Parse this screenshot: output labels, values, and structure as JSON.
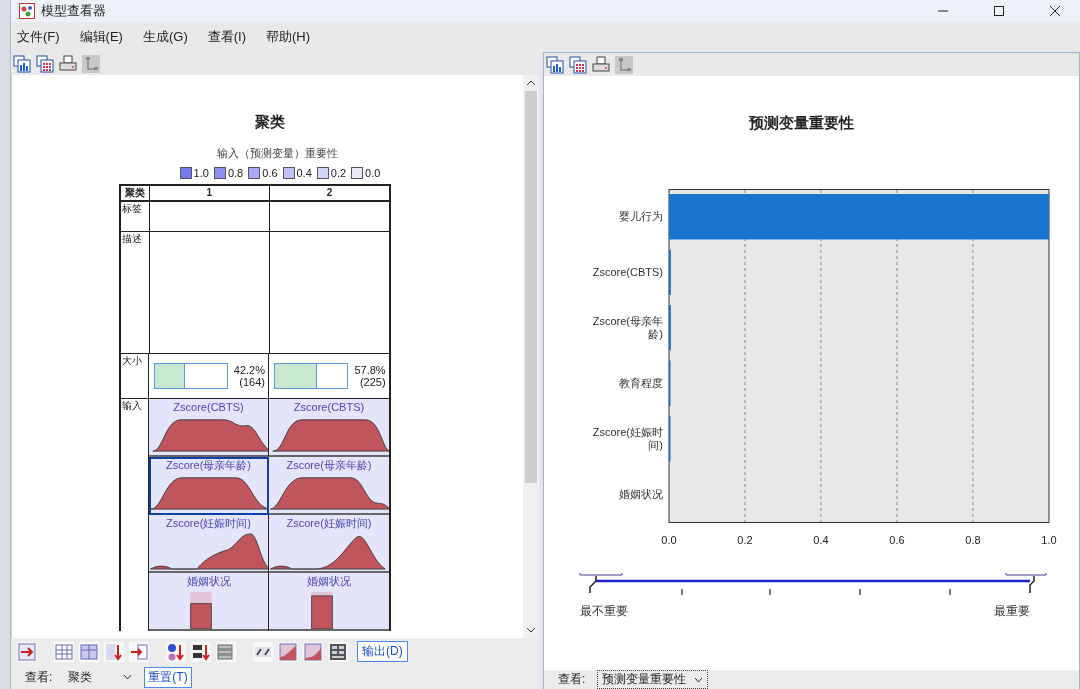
{
  "window": {
    "title": "模型查看器"
  },
  "menu": [
    "文件(F)",
    "编辑(E)",
    "生成(G)",
    "查看(I)",
    "帮助(H)"
  ],
  "cluster_view": {
    "title": "聚类",
    "subtitle": "输入（预测变量）重要性",
    "legend": [
      {
        "label": "1.0",
        "color": "#7878f0"
      },
      {
        "label": "0.8",
        "color": "#9090f0"
      },
      {
        "label": "0.6",
        "color": "#a8a8f4"
      },
      {
        "label": "0.4",
        "color": "#c0c0f6"
      },
      {
        "label": "0.2",
        "color": "#d4d4f8"
      },
      {
        "label": "0.0",
        "color": "#e8e8fa"
      }
    ],
    "table": {
      "columns": [
        "聚类",
        "1",
        "2"
      ],
      "label_row": "标签",
      "description_row": "描述",
      "size_row": {
        "header": "大小",
        "cells": [
          {
            "level": 0.422,
            "percent": "42.2%",
            "count": "(164)"
          },
          {
            "level": 0.578,
            "percent": "57.8%",
            "count": "(225)"
          }
        ]
      },
      "input_row": {
        "header": "输入",
        "features": [
          {
            "kind": "continuous",
            "cells": [
              {
                "name": "Zscore(CBTS)",
                "selected": false
              },
              {
                "name": "Zscore(CBTS)",
                "selected": false
              }
            ]
          },
          {
            "kind": "continuous",
            "cells": [
              {
                "name": "Zscore(母亲年龄)",
                "selected": true
              },
              {
                "name": "Zscore(母亲年龄)",
                "selected": false
              }
            ]
          },
          {
            "kind": "continuous",
            "cells": [
              {
                "name": "Zscore(妊娠时间)",
                "selected": false
              },
              {
                "name": "Zscore(妊娠时间)",
                "selected": false
              }
            ]
          },
          {
            "kind": "categorical",
            "cells": [
              {
                "name": "婚姻状况",
                "selected": false
              },
              {
                "name": "婚姻状况",
                "selected": false
              }
            ]
          }
        ]
      }
    },
    "output_button": "输出(D)",
    "view": {
      "label": "查看:",
      "value": "聚类",
      "reset_button": "重置(T)"
    }
  },
  "importance_view": {
    "title": "预测变量重要性",
    "chart_data": {
      "type": "bar",
      "orientation": "horizontal",
      "categories": [
        "婴儿行为",
        "Zscore(CBTS)",
        "Zscore(母亲年龄)",
        "教育程度",
        "Zscore(妊娠时间)",
        "婚姻状况"
      ],
      "series": [
        {
          "color": "#1a73cc",
          "values": [
            1.0,
            0.005,
            0.005,
            0.003,
            0.003,
            0.0
          ]
        }
      ],
      "grid": true,
      "xlim": [
        0,
        1
      ],
      "xticks": [
        {
          "value": 0,
          "label": "0.0"
        },
        {
          "value": 0.2,
          "label": "0.2"
        },
        {
          "value": 0.4,
          "label": "0.4"
        },
        {
          "value": 0.6,
          "label": "0.6"
        },
        {
          "value": 0.8,
          "label": "0.8"
        },
        {
          "value": 1,
          "label": "1.0"
        }
      ]
    },
    "scale": {
      "low": "最不重要",
      "high": "最重要"
    },
    "view": {
      "label": "查看:",
      "value": "预测变量重要性"
    }
  }
}
